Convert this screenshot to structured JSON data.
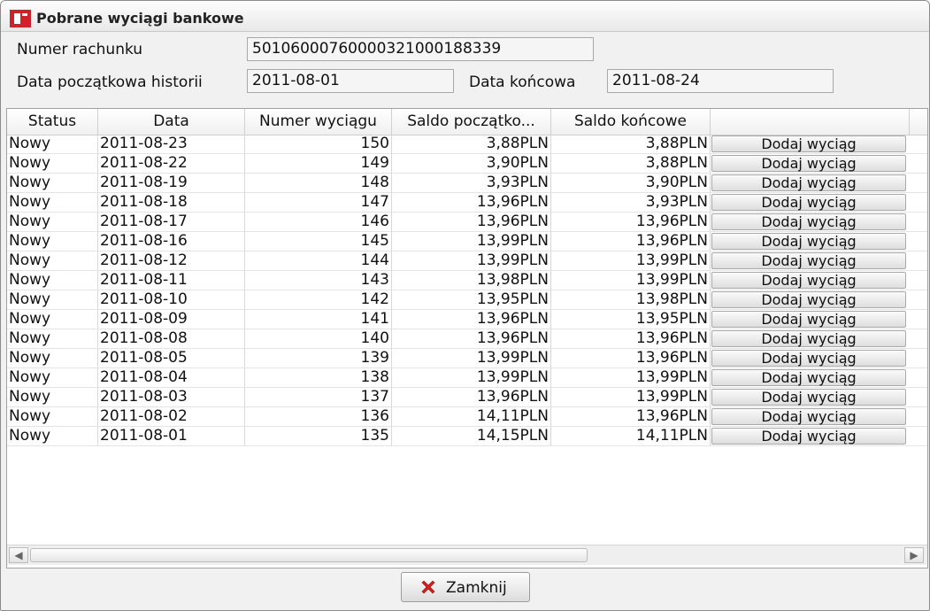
{
  "window": {
    "title": "Pobrane wyciągi bankowe"
  },
  "form": {
    "account_label": "Numer rachunku",
    "account_value": "50106000760000321000188339",
    "start_label": "Data początkowa historii",
    "start_value": "2011-08-01",
    "end_label": "Data końcowa",
    "end_value": "2011-08-24"
  },
  "table": {
    "columns": [
      "Status",
      "Data",
      "Numer wyciągu",
      "Saldo początko...",
      "Saldo końcowe",
      ""
    ],
    "button_label": "Dodaj wyciąg",
    "rows": [
      {
        "status": "Nowy",
        "date": "2011-08-23",
        "number": "150",
        "start": "3,88PLN",
        "end": "3,88PLN"
      },
      {
        "status": "Nowy",
        "date": "2011-08-22",
        "number": "149",
        "start": "3,90PLN",
        "end": "3,88PLN"
      },
      {
        "status": "Nowy",
        "date": "2011-08-19",
        "number": "148",
        "start": "3,93PLN",
        "end": "3,90PLN"
      },
      {
        "status": "Nowy",
        "date": "2011-08-18",
        "number": "147",
        "start": "13,96PLN",
        "end": "3,93PLN"
      },
      {
        "status": "Nowy",
        "date": "2011-08-17",
        "number": "146",
        "start": "13,96PLN",
        "end": "13,96PLN"
      },
      {
        "status": "Nowy",
        "date": "2011-08-16",
        "number": "145",
        "start": "13,99PLN",
        "end": "13,96PLN"
      },
      {
        "status": "Nowy",
        "date": "2011-08-12",
        "number": "144",
        "start": "13,99PLN",
        "end": "13,99PLN"
      },
      {
        "status": "Nowy",
        "date": "2011-08-11",
        "number": "143",
        "start": "13,98PLN",
        "end": "13,99PLN"
      },
      {
        "status": "Nowy",
        "date": "2011-08-10",
        "number": "142",
        "start": "13,95PLN",
        "end": "13,98PLN"
      },
      {
        "status": "Nowy",
        "date": "2011-08-09",
        "number": "141",
        "start": "13,96PLN",
        "end": "13,95PLN"
      },
      {
        "status": "Nowy",
        "date": "2011-08-08",
        "number": "140",
        "start": "13,96PLN",
        "end": "13,96PLN"
      },
      {
        "status": "Nowy",
        "date": "2011-08-05",
        "number": "139",
        "start": "13,99PLN",
        "end": "13,96PLN"
      },
      {
        "status": "Nowy",
        "date": "2011-08-04",
        "number": "138",
        "start": "13,99PLN",
        "end": "13,99PLN"
      },
      {
        "status": "Nowy",
        "date": "2011-08-03",
        "number": "137",
        "start": "13,96PLN",
        "end": "13,99PLN"
      },
      {
        "status": "Nowy",
        "date": "2011-08-02",
        "number": "136",
        "start": "14,11PLN",
        "end": "13,96PLN"
      },
      {
        "status": "Nowy",
        "date": "2011-08-01",
        "number": "135",
        "start": "14,15PLN",
        "end": "14,11PLN"
      }
    ]
  },
  "footer": {
    "close_label": "Zamknij"
  },
  "icons": {
    "app": "bank-logo-icon",
    "close": "red-x-icon",
    "scroll_left": "arrow-left-icon",
    "scroll_right": "arrow-right-icon"
  },
  "colors": {
    "logo_red": "#d0202a",
    "close_x": "#d61f1f"
  }
}
